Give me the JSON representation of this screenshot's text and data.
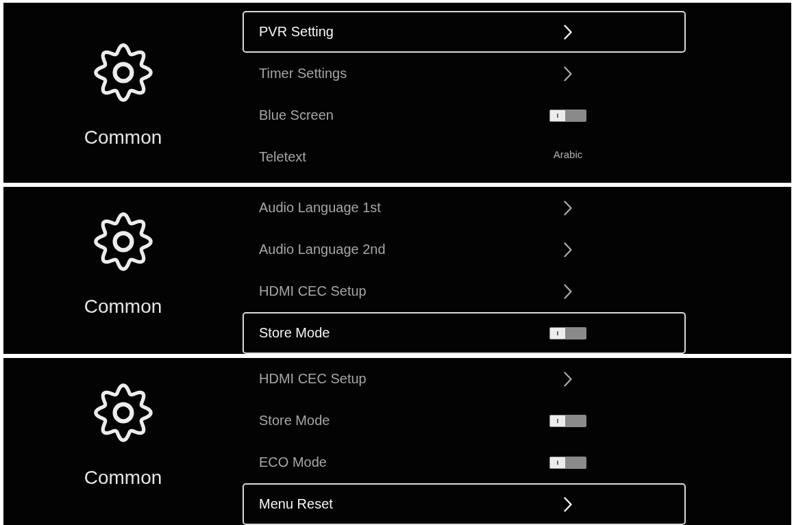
{
  "panels": [
    {
      "category": "Common",
      "items": [
        {
          "label": "PVR Setting",
          "kind": "submenu",
          "selected": true
        },
        {
          "label": "Timer Settings",
          "kind": "submenu",
          "selected": false
        },
        {
          "label": "Blue Screen",
          "kind": "toggle",
          "on": false,
          "selected": false
        },
        {
          "label": "Teletext",
          "kind": "value",
          "value": "Arabic",
          "selected": false
        }
      ]
    },
    {
      "category": "Common",
      "items": [
        {
          "label": "Audio Language 1st",
          "kind": "submenu",
          "selected": false
        },
        {
          "label": "Audio Language 2nd",
          "kind": "submenu",
          "selected": false
        },
        {
          "label": "HDMI CEC Setup",
          "kind": "submenu",
          "selected": false
        },
        {
          "label": "Store Mode",
          "kind": "toggle",
          "on": false,
          "selected": true
        }
      ]
    },
    {
      "category": "Common",
      "items": [
        {
          "label": "HDMI CEC Setup",
          "kind": "submenu",
          "selected": false
        },
        {
          "label": "Store Mode",
          "kind": "toggle",
          "on": false,
          "selected": false
        },
        {
          "label": "ECO Mode",
          "kind": "toggle",
          "on": false,
          "selected": false
        },
        {
          "label": "Menu Reset",
          "kind": "submenu",
          "selected": true
        }
      ]
    }
  ]
}
